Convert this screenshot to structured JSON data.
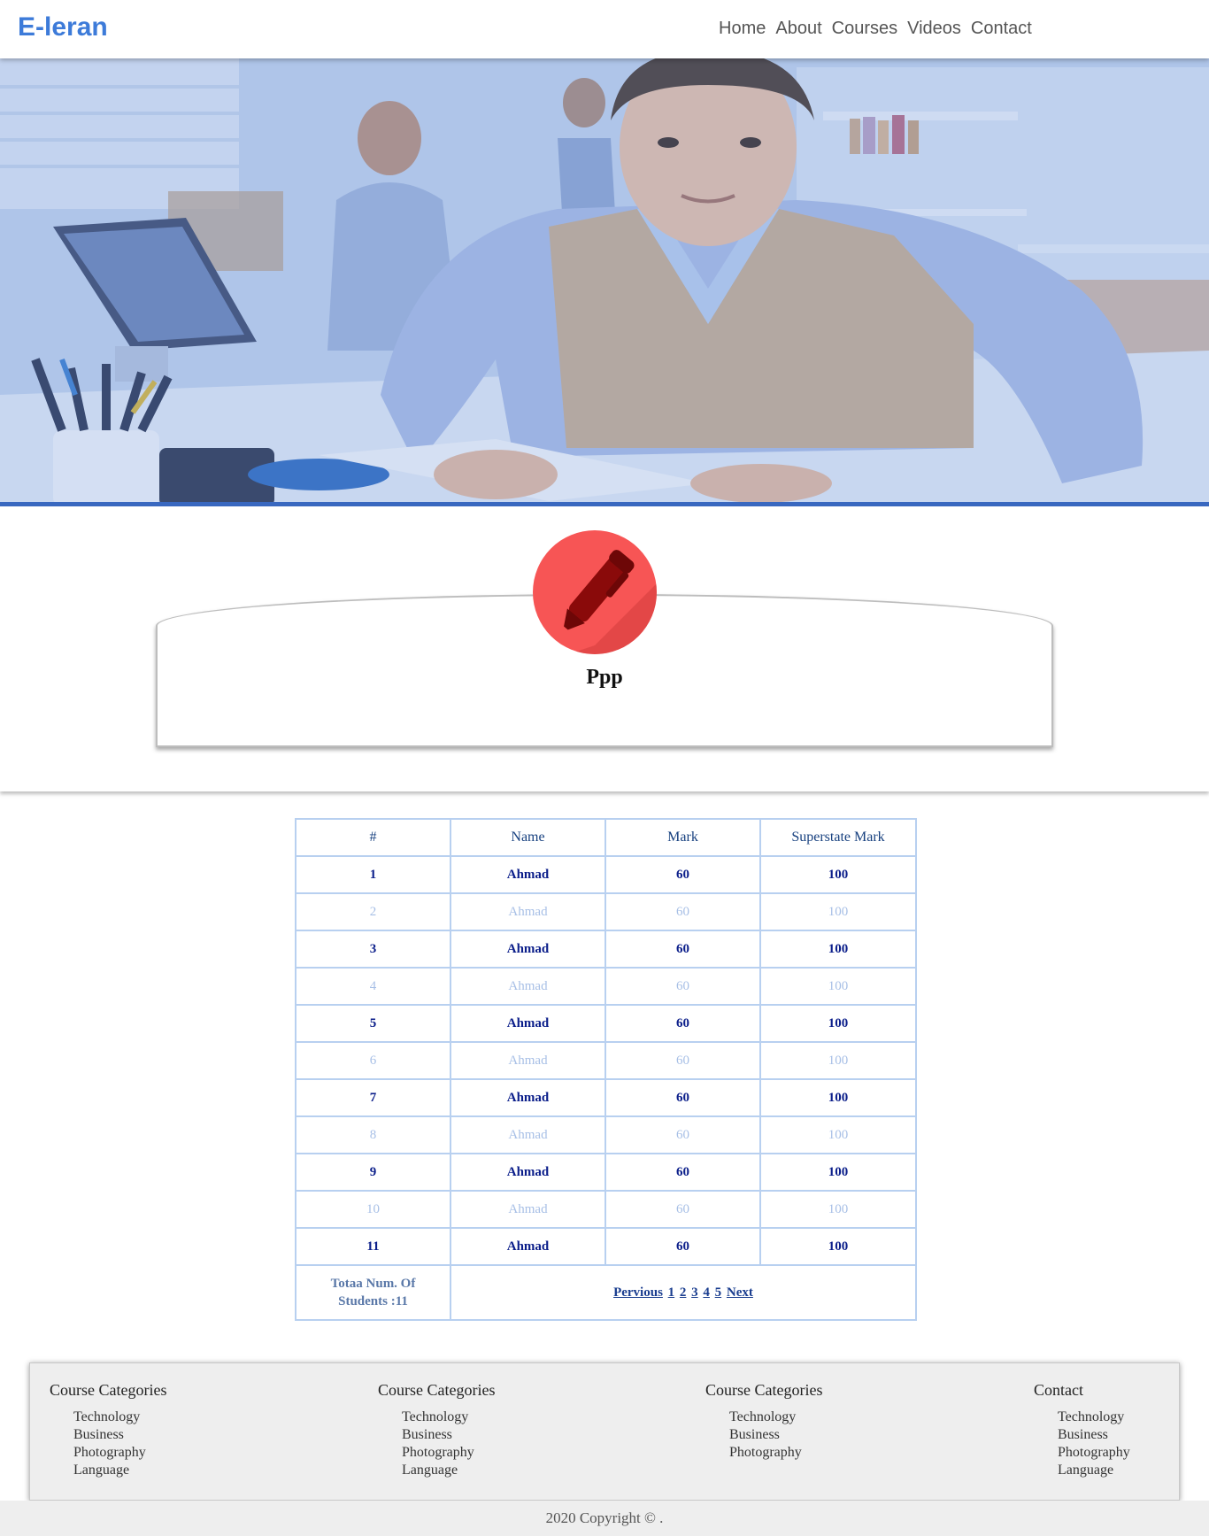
{
  "brand": "E-leran",
  "nav": [
    "Home",
    "About",
    "Courses",
    "Videos",
    "Contact"
  ],
  "hero": {
    "image": "office-student-photo"
  },
  "course": {
    "icon": "pen-icon",
    "title": "Ppp"
  },
  "table": {
    "headers": [
      "#",
      "Name",
      "Mark",
      "Superstate Mark"
    ],
    "rows": [
      [
        "1",
        "Ahmad",
        "60",
        "100"
      ],
      [
        "2",
        "Ahmad",
        "60",
        "100"
      ],
      [
        "3",
        "Ahmad",
        "60",
        "100"
      ],
      [
        "4",
        "Ahmad",
        "60",
        "100"
      ],
      [
        "5",
        "Ahmad",
        "60",
        "100"
      ],
      [
        "6",
        "Ahmad",
        "60",
        "100"
      ],
      [
        "7",
        "Ahmad",
        "60",
        "100"
      ],
      [
        "8",
        "Ahmad",
        "60",
        "100"
      ],
      [
        "9",
        "Ahmad",
        "60",
        "100"
      ],
      [
        "10",
        "Ahmad",
        "60",
        "100"
      ],
      [
        "11",
        "Ahmad",
        "60",
        "100"
      ]
    ],
    "total_line1": "Totaa Num. Of",
    "total_line2": "Students :11",
    "pager": [
      "Pervious",
      "1",
      "2",
      "3",
      "4",
      "5",
      "Next"
    ]
  },
  "footer": {
    "columns": [
      {
        "title": "Course Categories",
        "items": [
          "Technology",
          "Business",
          "Photography",
          "Language"
        ]
      },
      {
        "title": "Course Categories",
        "items": [
          "Technology",
          "Business",
          "Photography",
          "Language"
        ]
      },
      {
        "title": "Course Categories",
        "items": [
          "Technology",
          "Business",
          "Photography"
        ]
      },
      {
        "title": "Contact",
        "items": [
          "Technology",
          "Business",
          "Photography",
          "Language"
        ]
      }
    ],
    "copyright": "2020 Copyright © ."
  },
  "colors": {
    "brand": "#3d7bd9",
    "accent_bar": "#3968c0",
    "icon_circle": "#f75555",
    "table_border": "#b8d0f0"
  }
}
